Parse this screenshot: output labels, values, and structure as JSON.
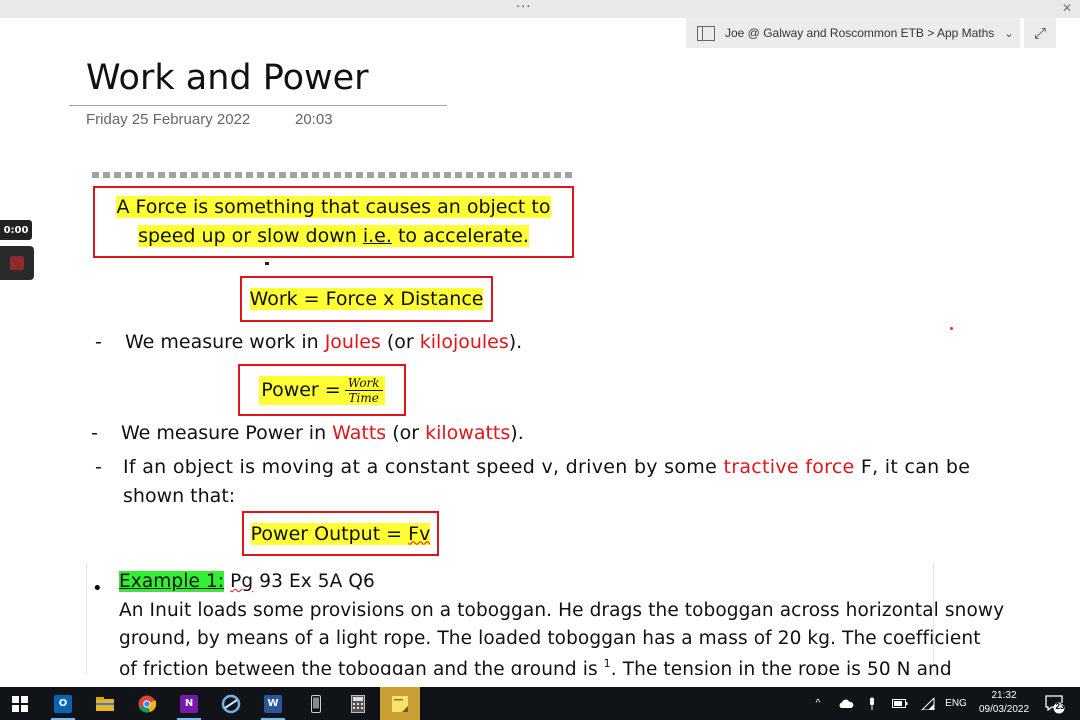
{
  "window": {
    "menu_dots": "···",
    "close_glyph": "✕"
  },
  "breadcrumb": {
    "text": "Joe @ Galway and Roscommon ETB > App Maths",
    "expand_glyph": "⤢"
  },
  "page": {
    "title": "Work and Power",
    "date": "Friday 25 February 2022",
    "time": "20:03"
  },
  "recorder": {
    "elapsed": "0:00"
  },
  "notes": {
    "definition_line1": "A Force is something that causes an object to",
    "definition_line2a": "speed up or slow down ",
    "definition_line2b": "i.e.",
    "definition_line2c": " to accelerate.",
    "work_formula": "Work = Force x Distance",
    "dash": "-",
    "work_unit_pre": "We measure work in ",
    "work_unit_joules": "Joules",
    "work_unit_mid": " (or ",
    "work_unit_kj": "kilojoules",
    "work_unit_post": ").",
    "power_lhs": "Power = ",
    "power_num": "Work",
    "power_den": "Time",
    "power_unit_pre": "We measure Power in ",
    "power_unit_watts": "Watts",
    "power_unit_mid": " (or ",
    "power_unit_kw": "kilowatts",
    "power_unit_post": ").",
    "tractive_pre": "If an object is moving at a constant speed v, driven by some ",
    "tractive_red": "tractive force",
    "tractive_post": " F, it can be",
    "tractive_line2": "shown that:",
    "output_lhs": "Power Output = ",
    "output_rhs": "Fv"
  },
  "example": {
    "bullet": "•",
    "label": "Example 1:",
    "ref_pg": "Pg",
    "ref_rest": " 93 Ex 5A Q6",
    "line1": "An Inuit loads some provisions on a toboggan. He drags the toboggan across horizontal snowy",
    "line2": "ground, by means of a light rope. The loaded toboggan has a mass of 20 kg. The coefficient",
    "line3a": "of friction between the toboggan and the ground is ",
    "line3_frac": "1",
    "line3b": ". The tension in the rope is 50 N and"
  },
  "taskbar": {
    "apps": [
      {
        "name": "start",
        "icon": "windows-icon"
      },
      {
        "name": "outlook",
        "icon": "outlook-icon",
        "letter": "O",
        "color": "#0a64b4"
      },
      {
        "name": "file-explorer",
        "icon": "folder-icon",
        "color": "#e8b624"
      },
      {
        "name": "chrome",
        "icon": "chrome-icon"
      },
      {
        "name": "onenote",
        "icon": "onenote-icon",
        "letter": "N",
        "color": "#7719aa"
      },
      {
        "name": "onenote-app",
        "icon": "onenote-app-icon",
        "color": "#3d7ebf"
      },
      {
        "name": "word",
        "icon": "word-icon",
        "letter": "W",
        "color": "#2b579a"
      },
      {
        "name": "phone",
        "icon": "phone-icon"
      },
      {
        "name": "calculator",
        "icon": "calculator-icon"
      },
      {
        "name": "sticky-notes",
        "icon": "sticky-notes-icon",
        "color": "#f7c600"
      }
    ],
    "tray": {
      "chevron": "^",
      "language": "ENG",
      "time": "21:32",
      "date": "09/03/2022",
      "notifications": "23"
    }
  },
  "colors": {
    "highlight": "#ffff33",
    "box_red": "#e0141b",
    "example_green": "#33ee33",
    "active_app": "#c8a034"
  }
}
